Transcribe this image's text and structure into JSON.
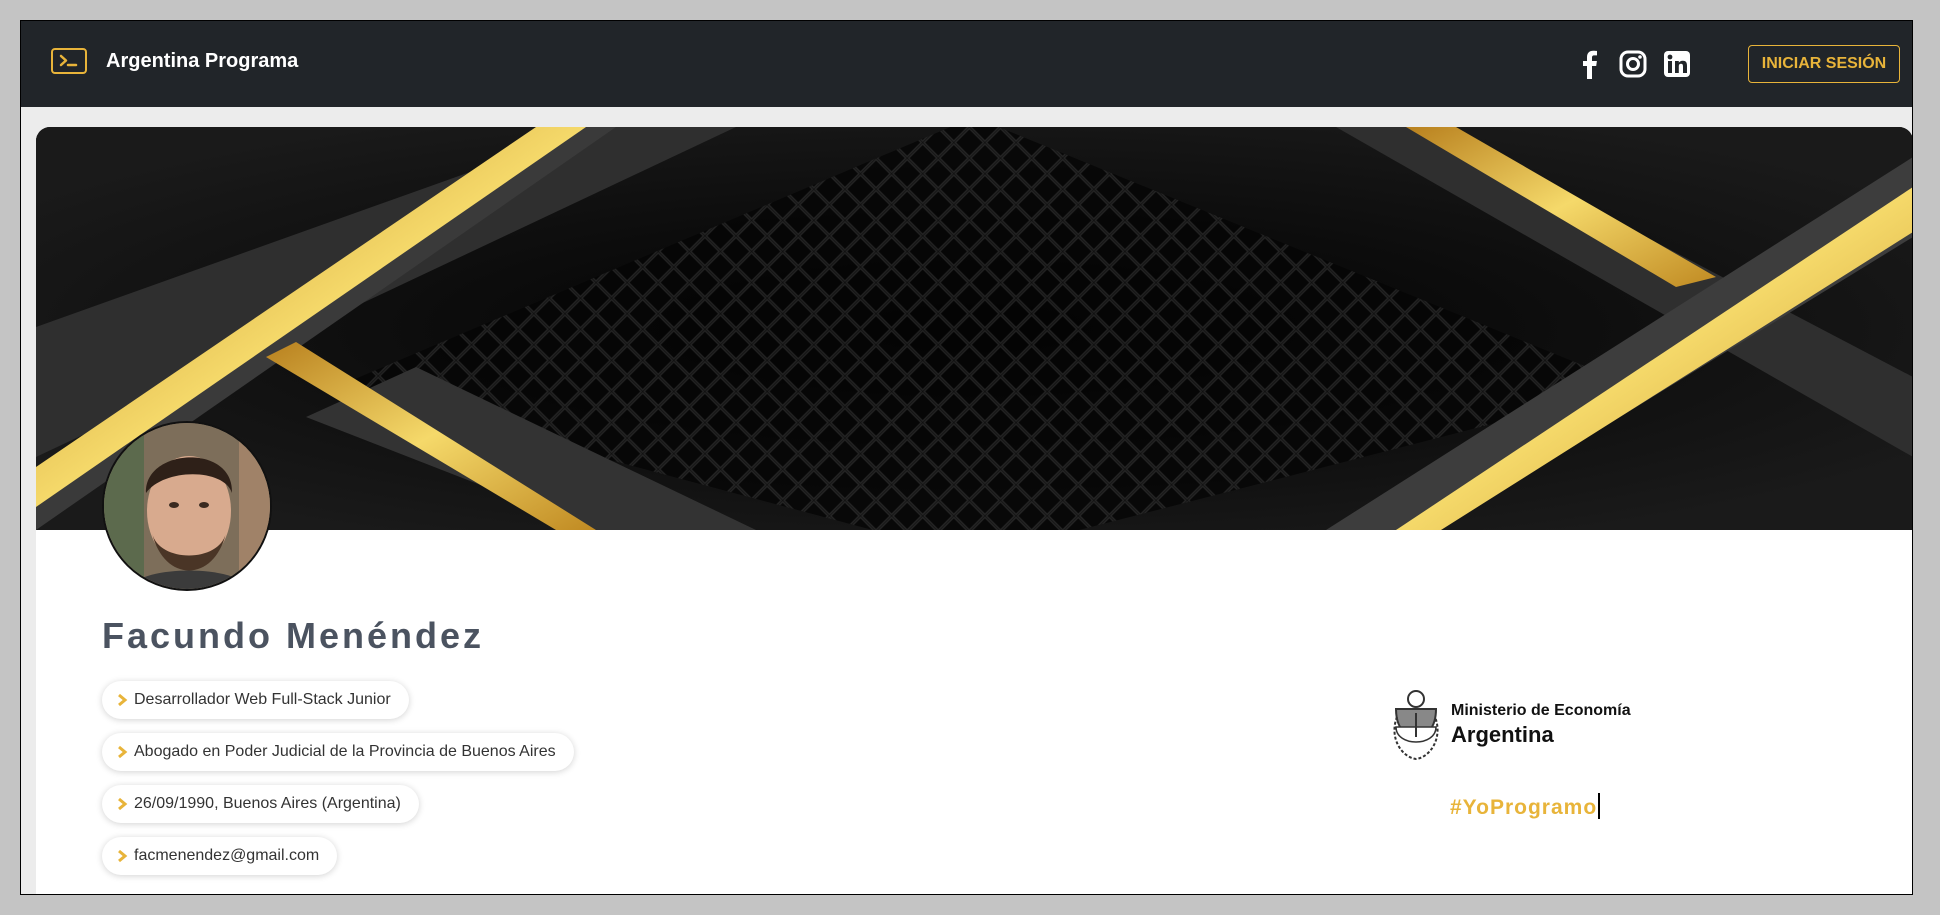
{
  "navbar": {
    "brand_title": "Argentina Programa",
    "socials": [
      {
        "icon": "facebook-icon"
      },
      {
        "icon": "instagram-icon"
      },
      {
        "icon": "linkedin-icon"
      }
    ],
    "login_label": "INICIAR SESIÓN"
  },
  "profile": {
    "name": "Facundo Menéndez",
    "info": [
      "Desarrollador Web Full-Stack Junior",
      "Abogado en Poder Judicial de la Provincia de Buenos Aires",
      "26/09/1990, Buenos Aires (Argentina)",
      "facmenendez@gmail.com"
    ]
  },
  "ministry": {
    "line1": "Ministerio de Economía",
    "line2": "Argentina"
  },
  "hashtag": "#YoProgramo",
  "colors": {
    "accent": "#e8b43a",
    "navbar_bg": "#212529",
    "name_text": "#4b5360"
  }
}
